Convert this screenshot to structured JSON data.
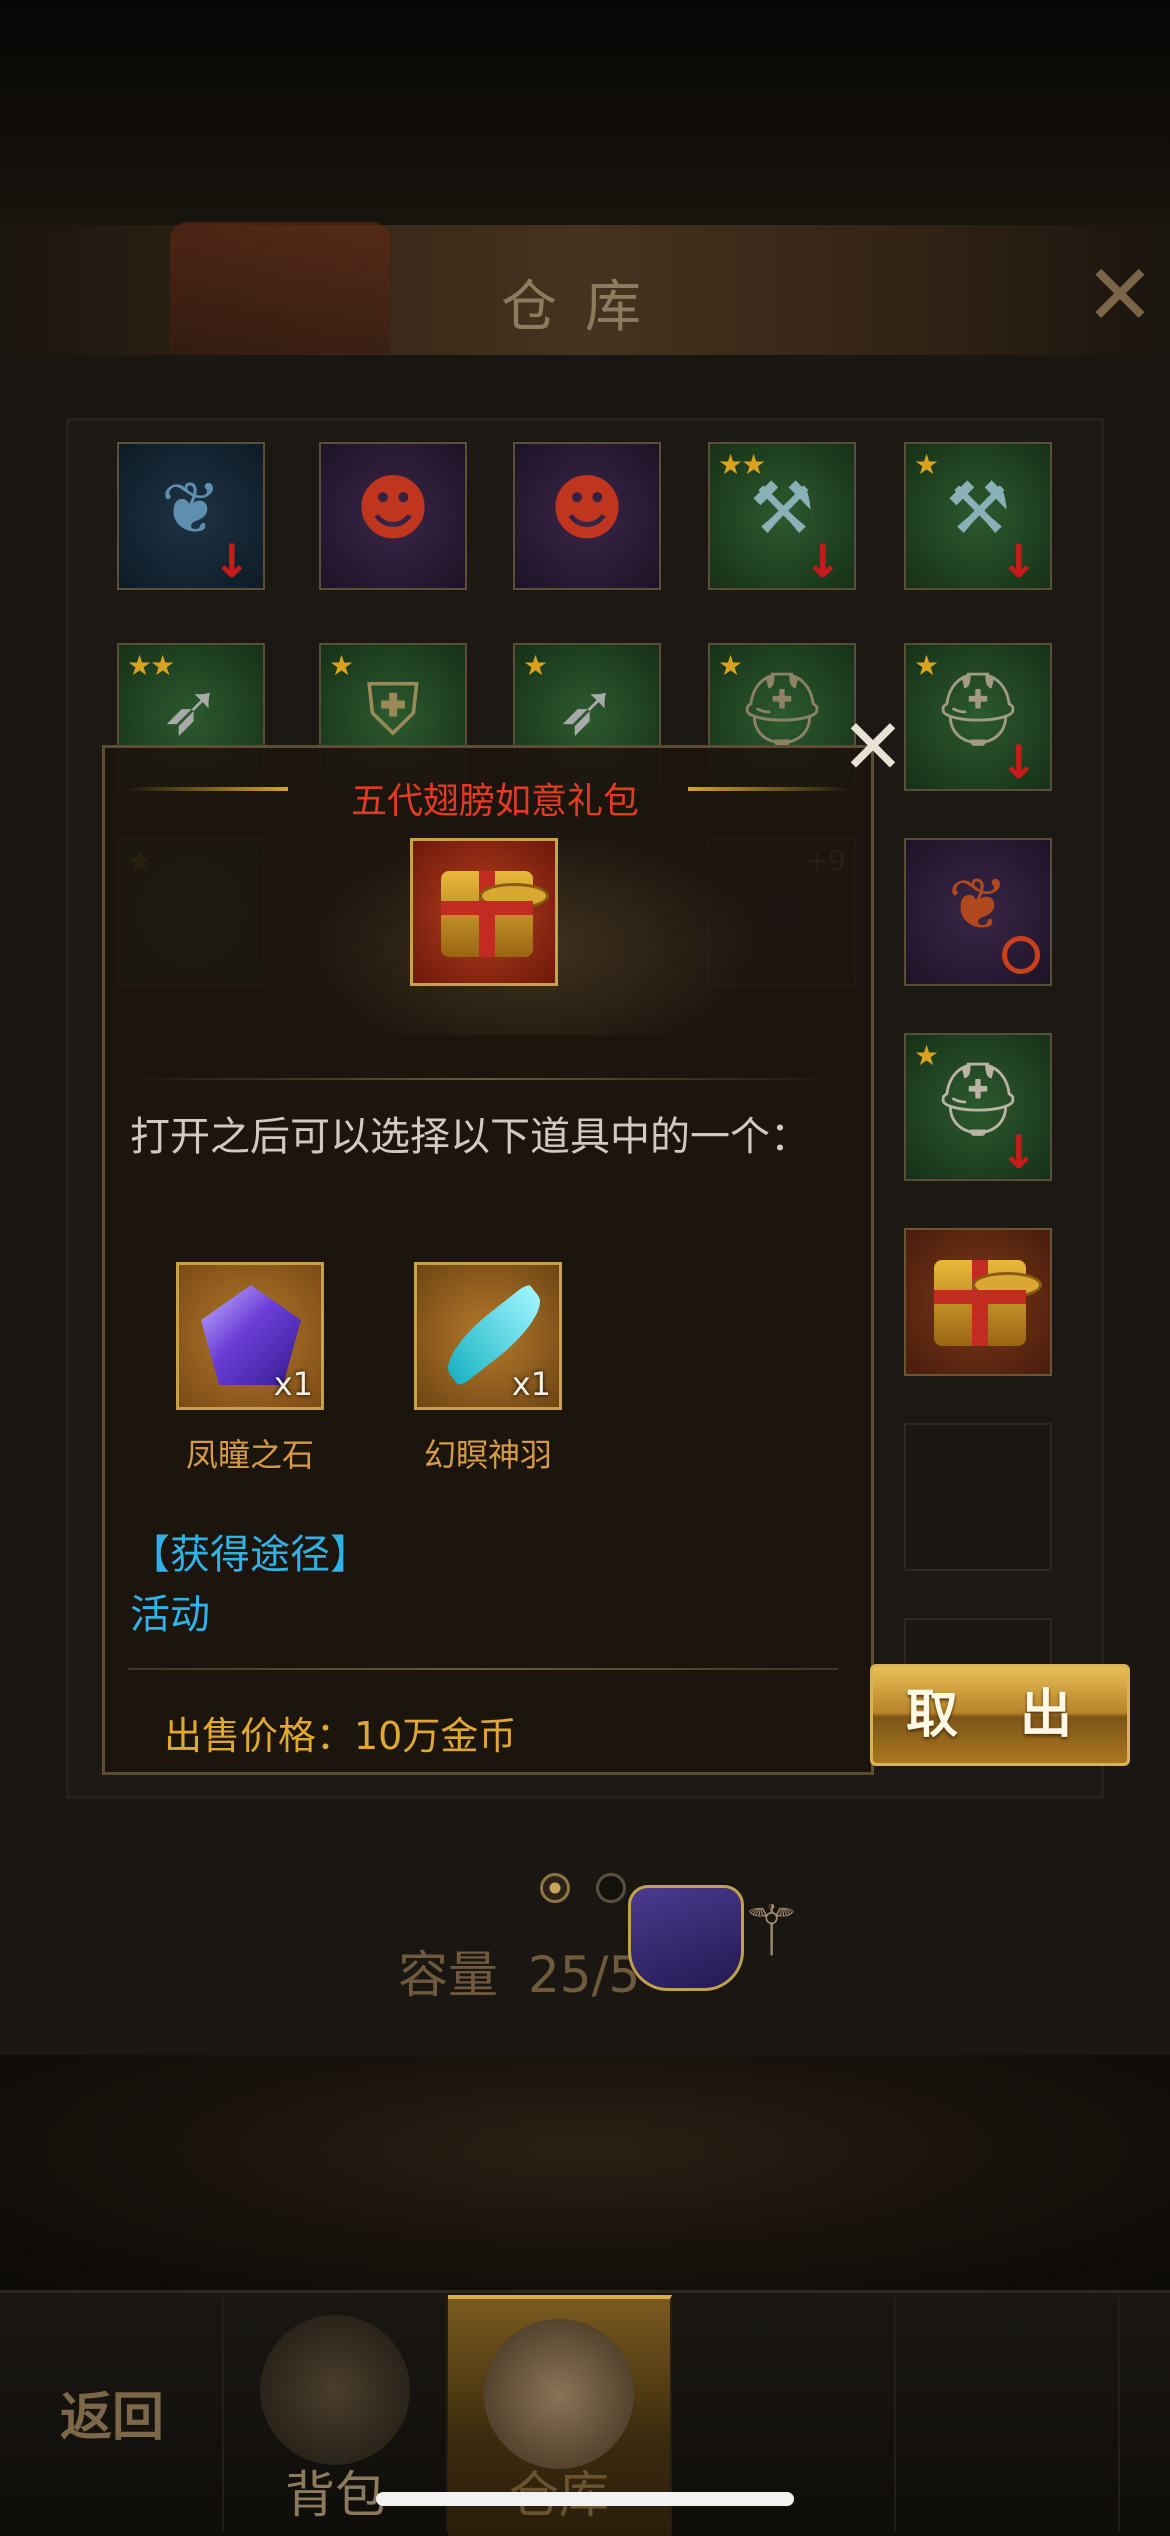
{
  "warehouse": {
    "title": "仓库",
    "capacity_label": "容量",
    "capacity_value": "25/5",
    "page_count": 2,
    "current_page": 1
  },
  "bottom_nav": {
    "back_label": "返回",
    "bag_label": "背包",
    "storage_label": "仓库"
  },
  "popup": {
    "title": "五代翅膀如意礼包",
    "description": "打开之后可以选择以下道具中的一个：",
    "rewards": [
      {
        "name": "凤瞳之石",
        "count": "x1",
        "icon": "purple-gem-icon"
      },
      {
        "name": "幻瞑神羽",
        "count": "x1",
        "icon": "feather-icon"
      }
    ],
    "source_title": "【获得途径】",
    "source_value": "活动",
    "sell_price": "出售价格：10万金币",
    "take_out_button": "取 出"
  },
  "slots_row3_plus": "+9",
  "colors": {
    "title_red": "#e23b24",
    "source_blue": "#2fb3e6",
    "price_gold": "#e0a833",
    "star_gold": "#d9a31f"
  }
}
